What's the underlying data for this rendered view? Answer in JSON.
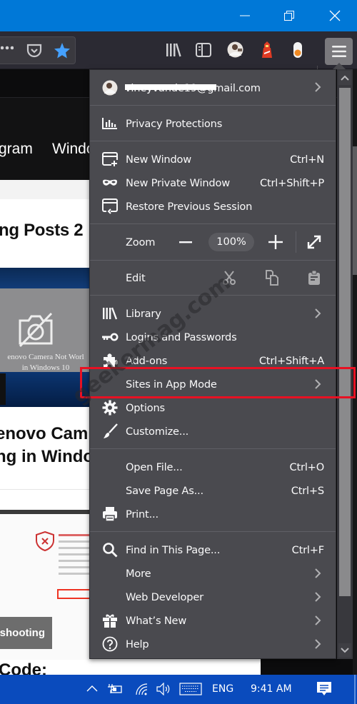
{
  "window": {
    "controls": {
      "minimize": "minimize",
      "maximize": "restore",
      "close": "close"
    }
  },
  "toolbar": {
    "icons": [
      "page-actions-icon",
      "pocket-icon",
      "bookmark-star-icon",
      "library-icon",
      "sidebar-icon",
      "account-avatar-icon",
      "lighthouse-extension-icon",
      "toggle-extension-icon",
      "hamburger-menu-icon"
    ],
    "bookmark_color": "#45a1ff"
  },
  "background_page": {
    "nav_items": [
      "gram",
      "Windo"
    ],
    "heading_trending": "ng Posts 2",
    "thumb_caption_line1": "enovo Camera Not Worl",
    "thumb_caption_line2": "in Windows 10",
    "article_title_line1": "enovo Cam",
    "article_title_line2": "ng in Windo",
    "button_label": "shooting",
    "code_heading": "Code:"
  },
  "menu": {
    "account": {
      "email": "vineyvande19@gmail.com"
    },
    "privacy": {
      "label": "Privacy Protections"
    },
    "window_items": [
      {
        "label": "New Window",
        "shortcut": "Ctrl+N",
        "icon": "new-window-icon"
      },
      {
        "label": "New Private Window",
        "shortcut": "Ctrl+Shift+P",
        "icon": "private-mask-icon"
      },
      {
        "label": "Restore Previous Session",
        "shortcut": "",
        "icon": "restore-session-icon"
      }
    ],
    "zoom": {
      "label": "Zoom",
      "value": "100%"
    },
    "edit": {
      "label": "Edit"
    },
    "tools_items": [
      {
        "label": "Library",
        "shortcut": "",
        "submenu": true
      },
      {
        "label": "Logins and Passwords",
        "shortcut": "",
        "submenu": false
      },
      {
        "label": "Add-ons",
        "shortcut": "Ctrl+Shift+A",
        "submenu": false
      },
      {
        "label": "Sites in App Mode",
        "shortcut": "",
        "submenu": true
      },
      {
        "label": "Options",
        "shortcut": "",
        "submenu": false
      },
      {
        "label": "Customize...",
        "shortcut": "",
        "submenu": false
      }
    ],
    "file_items": [
      {
        "label": "Open File...",
        "shortcut": "Ctrl+O"
      },
      {
        "label": "Save Page As...",
        "shortcut": "Ctrl+S"
      },
      {
        "label": "Print...",
        "shortcut": ""
      }
    ],
    "misc_items": [
      {
        "label": "Find in This Page...",
        "shortcut": "Ctrl+F",
        "submenu": false
      },
      {
        "label": "More",
        "shortcut": "",
        "submenu": true
      },
      {
        "label": "Web Developer",
        "shortcut": "",
        "submenu": true
      },
      {
        "label": "What’s New",
        "shortcut": "",
        "submenu": true
      },
      {
        "label": "Help",
        "shortcut": "",
        "submenu": true
      }
    ],
    "highlighted_item": "Sites in App Mode",
    "highlight_color": "#e81123"
  },
  "watermark": "geekermag.com",
  "taskbar": {
    "language": "ENG",
    "time": "9:41 AM",
    "color": "#0a4bbd"
  }
}
